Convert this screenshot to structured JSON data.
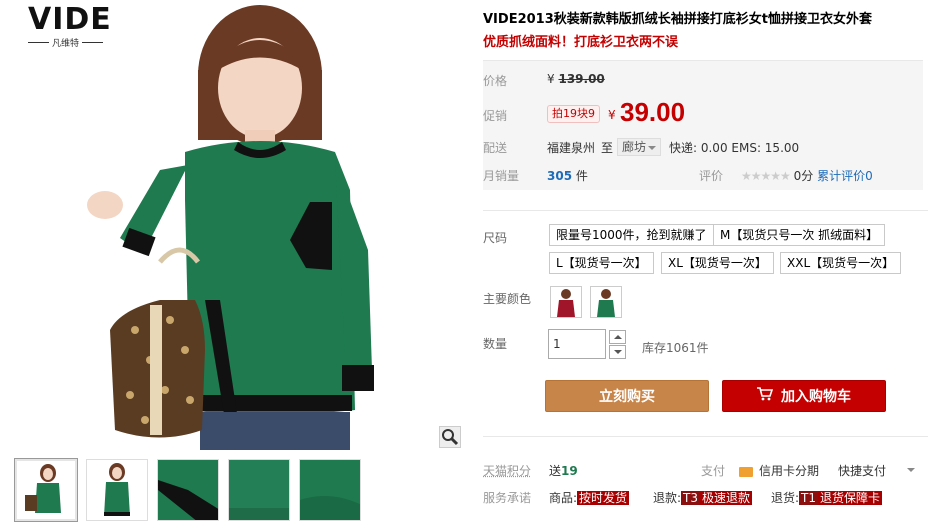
{
  "brand": {
    "name": "VIDE",
    "subname": "凡维特"
  },
  "product": {
    "title": "VIDE2013秋装新款韩版抓绒长袖拼接打底衫女t恤拼接卫衣女外套",
    "subtitle": "优质抓绒面料！打底衫卫衣两不误"
  },
  "price": {
    "label": "价格",
    "currency": "¥",
    "original": "139.00",
    "promo_label": "促销",
    "promo_tag": "拍19块9",
    "sale": "39.00"
  },
  "shipping": {
    "label": "配送",
    "origin": "福建泉州",
    "to": "至",
    "destination": "廊坊",
    "fees": "快递: 0.00 EMS: 15.00"
  },
  "sales": {
    "label": "月销量",
    "count": "305",
    "unit": "件",
    "rating_label": "评价",
    "stars": "★★★★★",
    "score": "0分",
    "review_link": "累计评价0"
  },
  "size": {
    "label": "尺码",
    "options": [
      "限量号1000件，抢到就赚了",
      "M【现货只号一次 抓绒面料】",
      "L【现货号一次】",
      "XL【现货号一次】",
      "XXL【现货号一次】"
    ]
  },
  "color": {
    "label": "主要颜色",
    "swatches": [
      "red-sweater-swatch",
      "green-sweater-swatch"
    ]
  },
  "quantity": {
    "label": "数量",
    "value": "1",
    "stock": "库存1061件"
  },
  "actions": {
    "buy_now": "立刻购买",
    "add_to_cart": "加入购物车"
  },
  "rewards": {
    "points_label": "天猫积分",
    "points_prefix": "送",
    "points_value": "19",
    "pay_label": "支付",
    "credit_card": "信用卡分期",
    "quick_pay": "快捷支付"
  },
  "service": {
    "label": "服务承诺",
    "goods_prefix": "商品:",
    "goods_tag": "按时发货",
    "refund_prefix": "退款:",
    "refund_code": "T3",
    "refund_tag": "极速退款",
    "return_prefix": "退货:",
    "return_code": "T1",
    "return_tag": "退货保障卡"
  },
  "colors": {
    "accent_red": "#c40000",
    "buy_orange": "#c8854a",
    "link_blue": "#1e6bb8",
    "sweater_green": "#1f7a4f"
  }
}
